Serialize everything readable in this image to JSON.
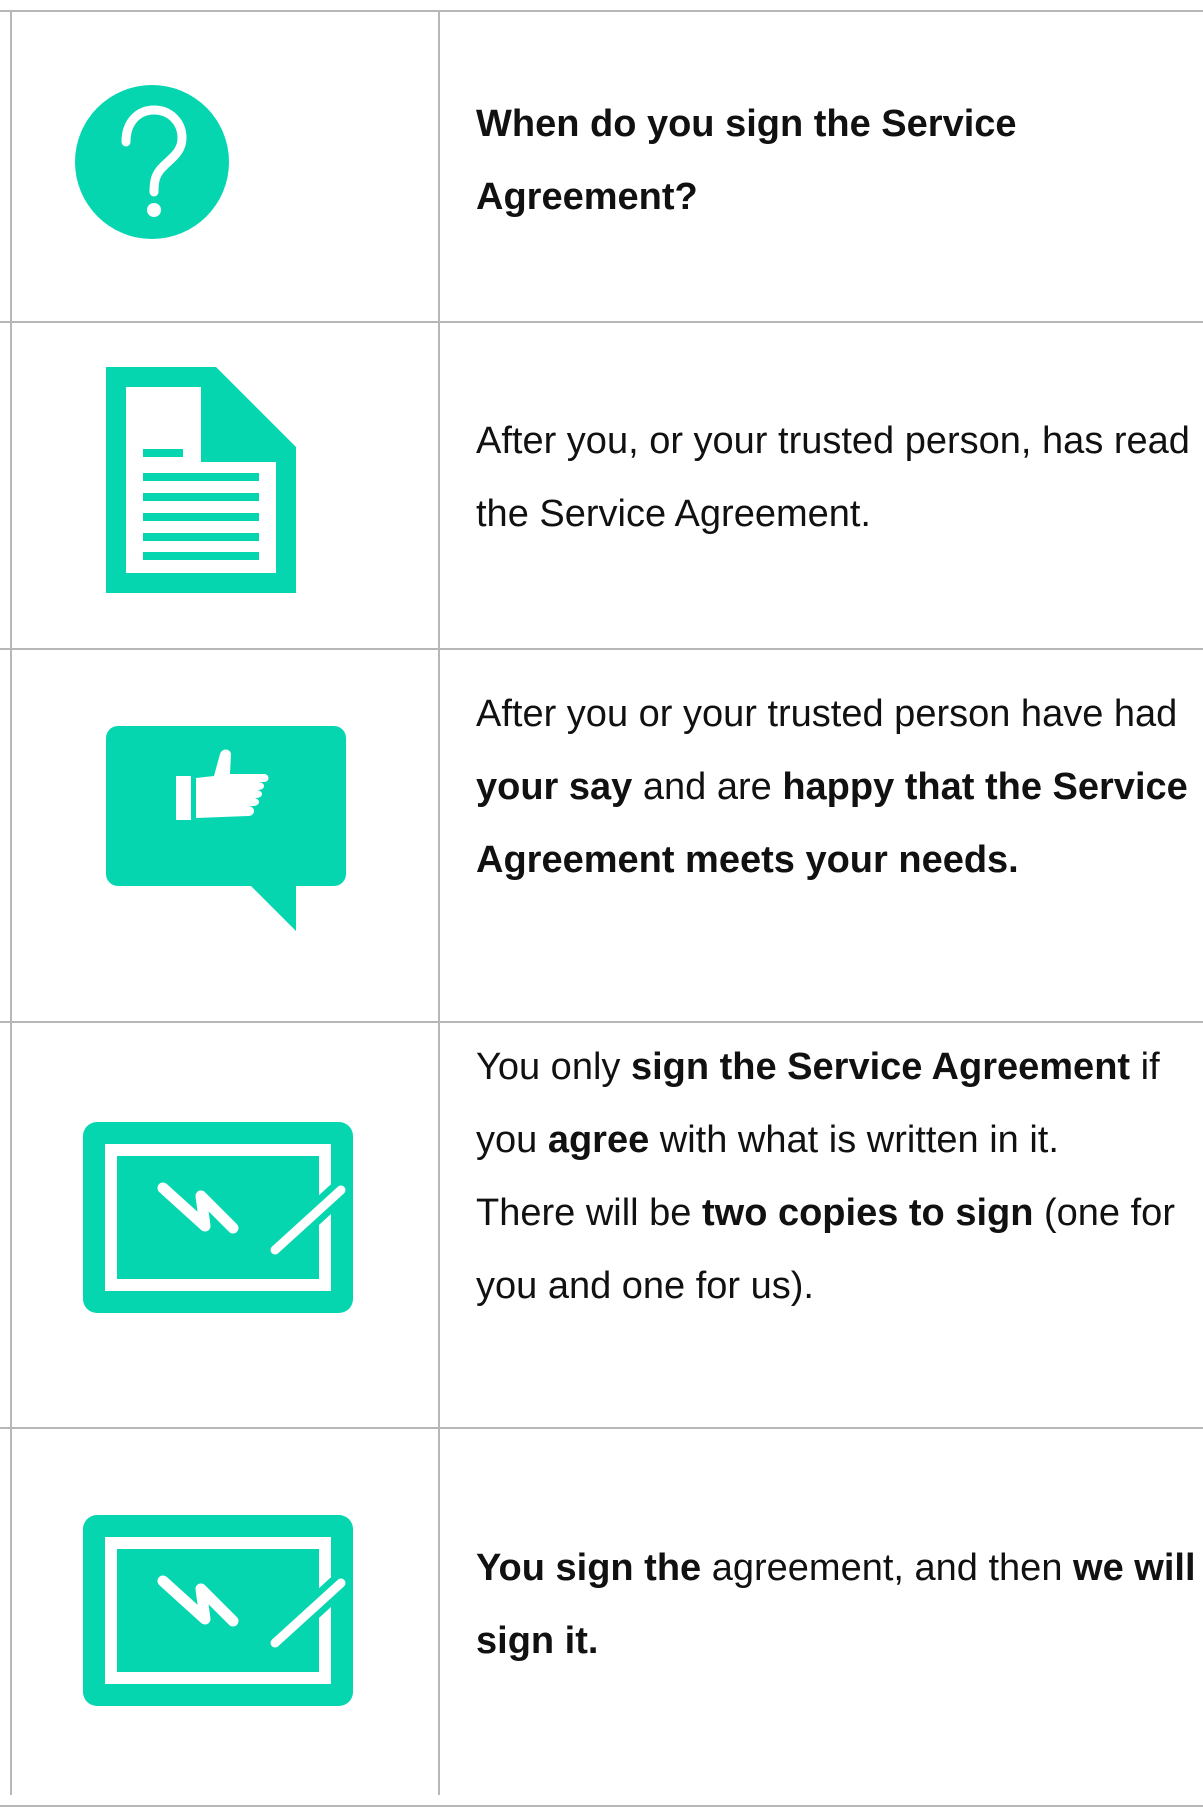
{
  "accent_color": "#06d6b0",
  "rows": [
    {
      "icon": "question-circle-icon",
      "text_parts": [
        {
          "t": "When do you sign the Service Agreement?",
          "bold": true
        }
      ]
    },
    {
      "icon": "document-icon",
      "text_parts": [
        {
          "t": "After you, or your trusted person, has read the Service Agreement.",
          "bold": false
        }
      ]
    },
    {
      "icon": "thumbs-up-speech-bubble-icon",
      "text_parts": [
        {
          "t": "After you or your trusted person have had ",
          "bold": false
        },
        {
          "t": "your say",
          "bold": true
        },
        {
          "t": " and are ",
          "bold": false
        },
        {
          "t": "happy that the Service Agreement meets your needs.",
          "bold": true
        }
      ]
    },
    {
      "icon": "signature-icon",
      "text_parts": [
        {
          "t": "You only ",
          "bold": false
        },
        {
          "t": "sign the Service Agreement",
          "bold": true
        },
        {
          "t": " if you ",
          "bold": false
        },
        {
          "t": "agree",
          "bold": true
        },
        {
          "t": " with what is written in it.",
          "bold": false
        },
        {
          "br": true
        },
        {
          "t": "There will be ",
          "bold": false
        },
        {
          "t": "two copies to sign",
          "bold": true
        },
        {
          "t": " (one for you and one for us).",
          "bold": false
        }
      ]
    },
    {
      "icon": "signature-icon",
      "text_parts": [
        {
          "t": "You sign the",
          "bold": true
        },
        {
          "t": " agreement, and then ",
          "bold": false
        },
        {
          "t": "we will sign it.",
          "bold": true
        }
      ]
    }
  ]
}
